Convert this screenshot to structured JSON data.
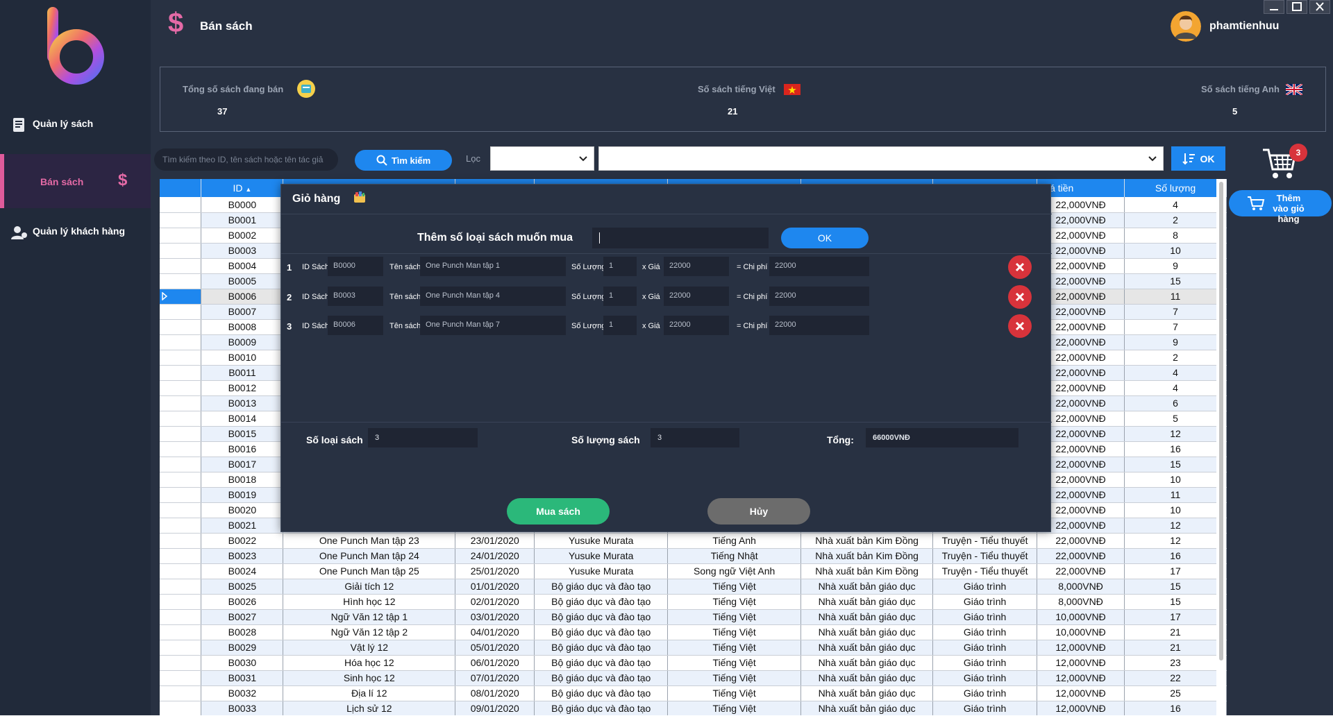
{
  "sidebar": {
    "items": [
      {
        "label": "Quản lý sách",
        "icon": "book-icon"
      },
      {
        "label": "Bán sách",
        "icon": "dollar-icon"
      },
      {
        "label": "Quản lý khách hàng",
        "icon": "users-icon"
      }
    ]
  },
  "header": {
    "title": "Bán sách",
    "username": "phamtienhuu"
  },
  "stats": {
    "total": {
      "label": "Tổng số sách đang bán",
      "value": "37"
    },
    "vietnamese": {
      "label": "Số sách tiếng Việt",
      "value": "21"
    },
    "english": {
      "label": "Số sách tiếng Anh",
      "value": "5"
    }
  },
  "toolbar": {
    "search_placeholder": "Tìm kiếm theo ID, tên sách hoặc tên tác giả",
    "search_button": "Tìm kiếm",
    "filter_label": "Lọc",
    "filter_value_1": "",
    "filter_value_2": "",
    "ok_button": "OK",
    "cart_count": "3",
    "add_to_cart": "Thêm vào giỏ hàng"
  },
  "table": {
    "headers": [
      "ID",
      "",
      "",
      "",
      "",
      "",
      "",
      "Giá tiền",
      "Số lượng"
    ],
    "selected_id": "B0006",
    "rows": [
      [
        "B0000",
        "",
        "",
        "",
        "",
        "",
        "",
        "22,000VNĐ",
        "4"
      ],
      [
        "B0001",
        "",
        "",
        "",
        "",
        "",
        "",
        "22,000VNĐ",
        "2"
      ],
      [
        "B0002",
        "",
        "",
        "",
        "",
        "",
        "",
        "22,000VNĐ",
        "8"
      ],
      [
        "B0003",
        "",
        "",
        "",
        "",
        "",
        "",
        "22,000VNĐ",
        "10"
      ],
      [
        "B0004",
        "",
        "",
        "",
        "",
        "",
        "",
        "22,000VNĐ",
        "9"
      ],
      [
        "B0005",
        "",
        "",
        "",
        "",
        "",
        "",
        "22,000VNĐ",
        "15"
      ],
      [
        "B0006",
        "",
        "",
        "",
        "",
        "",
        "",
        "22,000VNĐ",
        "11"
      ],
      [
        "B0007",
        "",
        "",
        "",
        "",
        "",
        "",
        "22,000VNĐ",
        "7"
      ],
      [
        "B0008",
        "",
        "",
        "",
        "",
        "",
        "",
        "22,000VNĐ",
        "7"
      ],
      [
        "B0009",
        "",
        "",
        "",
        "",
        "",
        "",
        "22,000VNĐ",
        "9"
      ],
      [
        "B0010",
        "",
        "",
        "",
        "",
        "",
        "",
        "22,000VNĐ",
        "2"
      ],
      [
        "B0011",
        "",
        "",
        "",
        "",
        "",
        "",
        "22,000VNĐ",
        "4"
      ],
      [
        "B0012",
        "",
        "",
        "",
        "",
        "",
        "",
        "22,000VNĐ",
        "4"
      ],
      [
        "B0013",
        "",
        "",
        "",
        "",
        "",
        "",
        "22,000VNĐ",
        "6"
      ],
      [
        "B0014",
        "",
        "",
        "",
        "",
        "",
        "",
        "22,000VNĐ",
        "5"
      ],
      [
        "B0015",
        "",
        "",
        "",
        "",
        "",
        "",
        "22,000VNĐ",
        "12"
      ],
      [
        "B0016",
        "",
        "",
        "",
        "",
        "",
        "",
        "22,000VNĐ",
        "16"
      ],
      [
        "B0017",
        "",
        "",
        "",
        "",
        "",
        "",
        "22,000VNĐ",
        "15"
      ],
      [
        "B0018",
        "",
        "",
        "",
        "",
        "",
        "",
        "22,000VNĐ",
        "10"
      ],
      [
        "B0019",
        "",
        "",
        "",
        "",
        "",
        "",
        "22,000VNĐ",
        "11"
      ],
      [
        "B0020",
        "",
        "",
        "",
        "",
        "",
        "",
        "22,000VNĐ",
        "10"
      ],
      [
        "B0021",
        "",
        "",
        "",
        "",
        "",
        "",
        "22,000VNĐ",
        "12"
      ],
      [
        "B0022",
        "One Punch Man tập 23",
        "23/01/2020",
        "Yusuke Murata",
        "Tiếng Anh",
        "Nhà xuất bản Kim Đồng",
        "Truyện - Tiểu thuyết",
        "22,000VNĐ",
        "12"
      ],
      [
        "B0023",
        "One Punch Man tập 24",
        "24/01/2020",
        "Yusuke Murata",
        "Tiếng Nhật",
        "Nhà xuất bản Kim Đồng",
        "Truyện - Tiểu thuyết",
        "22,000VNĐ",
        "16"
      ],
      [
        "B0024",
        "One Punch Man tập 25",
        "25/01/2020",
        "Yusuke Murata",
        "Song ngữ Việt Anh",
        "Nhà xuất bản Kim Đồng",
        "Truyện - Tiểu thuyết",
        "22,000VNĐ",
        "17"
      ],
      [
        "B0025",
        "Giải tích 12",
        "01/01/2020",
        "Bộ giáo dục và đào tạo",
        "Tiếng Việt",
        "Nhà xuất bản giáo dục",
        "Giáo trình",
        "8,000VNĐ",
        "15"
      ],
      [
        "B0026",
        "Hình học 12",
        "02/01/2020",
        "Bộ giáo dục và đào tạo",
        "Tiếng Việt",
        "Nhà xuất bản giáo dục",
        "Giáo trình",
        "8,000VNĐ",
        "15"
      ],
      [
        "B0027",
        "Ngữ Văn 12 tập 1",
        "03/01/2020",
        "Bộ giáo dục và đào tạo",
        "Tiếng Việt",
        "Nhà xuất bản giáo dục",
        "Giáo trình",
        "10,000VNĐ",
        "17"
      ],
      [
        "B0028",
        "Ngữ Văn 12 tập 2",
        "04/01/2020",
        "Bộ giáo dục và đào tạo",
        "Tiếng Việt",
        "Nhà xuất bản giáo dục",
        "Giáo trình",
        "10,000VNĐ",
        "21"
      ],
      [
        "B0029",
        "Vật lý 12",
        "05/01/2020",
        "Bộ giáo dục và đào tạo",
        "Tiếng Việt",
        "Nhà xuất bản giáo dục",
        "Giáo trình",
        "12,000VNĐ",
        "21"
      ],
      [
        "B0030",
        "Hóa học 12",
        "06/01/2020",
        "Bộ giáo dục và đào tạo",
        "Tiếng Việt",
        "Nhà xuất bản giáo dục",
        "Giáo trình",
        "12,000VNĐ",
        "23"
      ],
      [
        "B0031",
        "Sinh học 12",
        "07/01/2020",
        "Bộ giáo dục và đào tạo",
        "Tiếng Việt",
        "Nhà xuất bản giáo dục",
        "Giáo trình",
        "12,000VNĐ",
        "22"
      ],
      [
        "B0032",
        "Địa lí 12",
        "08/01/2020",
        "Bộ giáo dục và đào tạo",
        "Tiếng Việt",
        "Nhà xuất bản giáo dục",
        "Giáo trình",
        "12,000VNĐ",
        "25"
      ],
      [
        "B0033",
        "Lịch sử 12",
        "09/01/2020",
        "Bộ giáo dục và đào tạo",
        "Tiếng Việt",
        "Nhà xuất bản giáo dục",
        "Giáo trình",
        "12,000VNĐ",
        "16"
      ]
    ]
  },
  "cart_modal": {
    "title": "Giỏ hàng",
    "qty_label": "Thêm số loại sách muốn mua",
    "qty_value": "",
    "ok_button": "OK",
    "field_labels": {
      "id": "ID Sách",
      "name": "Tên sách",
      "qty": "Số Lượng",
      "price": "x  Giá",
      "cost": "=  Chi phí"
    },
    "items": [
      {
        "num": "1",
        "id": "B0000",
        "name": "One Punch Man tập 1",
        "qty": "1",
        "price": "22000",
        "cost": "22000"
      },
      {
        "num": "2",
        "id": "B0003",
        "name": "One Punch Man tập 4",
        "qty": "1",
        "price": "22000",
        "cost": "22000"
      },
      {
        "num": "3",
        "id": "B0006",
        "name": "One Punch Man tập 7",
        "qty": "1",
        "price": "22000",
        "cost": "22000"
      }
    ],
    "summary": {
      "types_label": "Số loại sách",
      "types_value": "3",
      "count_label": "Số lượng sách",
      "count_value": "3",
      "total_label": "Tổng:",
      "total_value": "66000VNĐ"
    },
    "buy_button": "Mua sách",
    "cancel_button": "Hủy"
  },
  "colors": {
    "accent": "#1e87ef",
    "pink": "#e46aa6",
    "danger": "#d8333b",
    "success": "#2bb87a",
    "bg": "#283142",
    "sidebar": "#212a3a"
  }
}
